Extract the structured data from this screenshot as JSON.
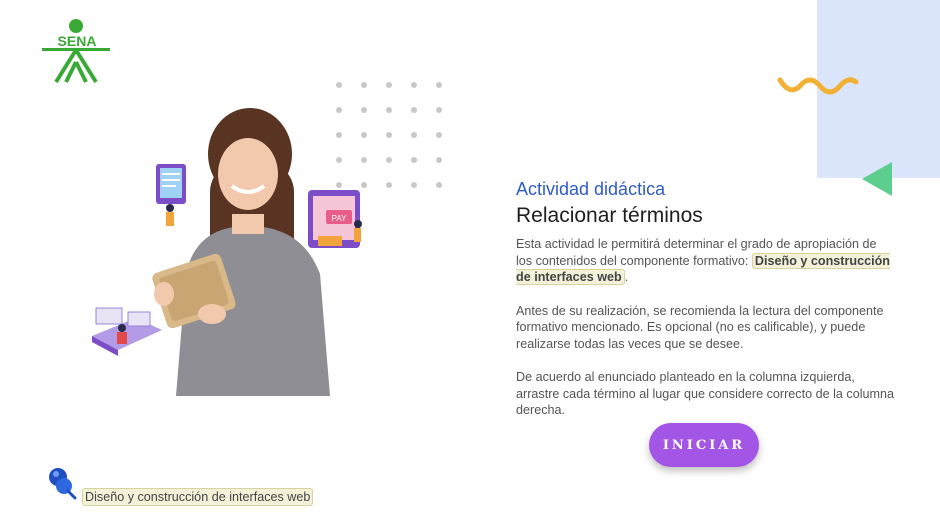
{
  "logo": {
    "text": "SENA",
    "icon": "sena-logo-icon",
    "color": "#39a935"
  },
  "accent_colors": {
    "panel": "#dbe5fb",
    "wave": "#f2b134",
    "triangle": "#5ccf8f",
    "button": "#a355e6",
    "kicker": "#2f5dc6"
  },
  "activity": {
    "kicker": "Actividad didáctica",
    "title": "Relacionar términos",
    "p1_text": "Esta actividad le permitirá determinar el grado de apropiación de los contenidos del componente formativo: ",
    "p1_highlight": "Diseño y construcción de interfaces web",
    "p1_end": ".",
    "p2": "Antes de su realización, se recomienda la lectura del componente formativo mencionado.  Es opcional (no es calificable), y puede realizarse todas las veces que se desee.",
    "p3": "De acuerdo al enunciado planteado en la columna izquierda, arrastre cada término al lugar que considere correcto de la columna derecha."
  },
  "start_button": {
    "label": "INICIAR"
  },
  "footer": {
    "label": "Diseño y construcción de interfaces web",
    "icon": "pushpin-icon"
  },
  "hero": {
    "icon": "woman-with-tablet-illustration"
  }
}
